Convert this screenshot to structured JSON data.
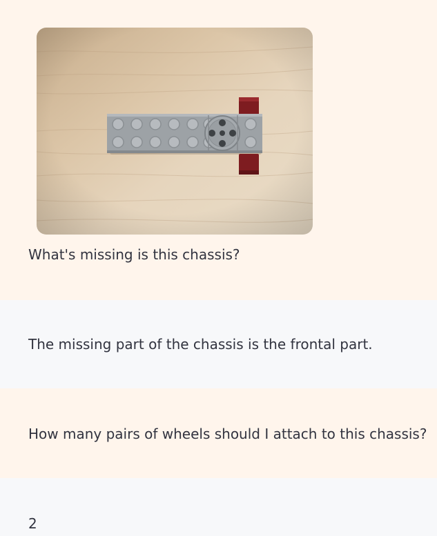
{
  "messages": [
    {
      "role": "user",
      "text": "What's missing is this chassis?"
    },
    {
      "role": "assistant",
      "text": "The missing part of the chassis is the frontal part."
    },
    {
      "role": "user",
      "text": "How many pairs of wheels should I attach to this chassis?"
    },
    {
      "role": "assistant",
      "text": "2"
    }
  ],
  "colors": {
    "user_bg": "#fff5ec",
    "assistant_bg": "#f7f8fa",
    "text": "#31333f"
  }
}
